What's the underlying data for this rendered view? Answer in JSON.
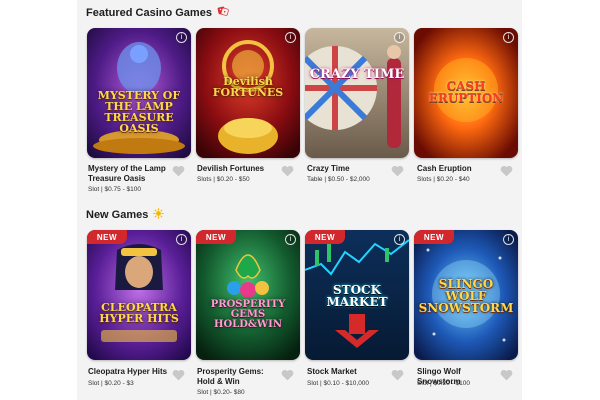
{
  "sections": {
    "featured": {
      "title": "Featured Casino Games",
      "icon": "dice-icon"
    },
    "new": {
      "title": "New Games",
      "icon": "sparkle-icon"
    }
  },
  "badges": {
    "new_label": "NEW"
  },
  "featured_games": [
    {
      "name": "Mystery of the Lamp Treasure Oasis",
      "meta": "Slot | $0.75 - $100",
      "logo": "MYSTERY OF THE LAMP TREASURE OASIS"
    },
    {
      "name": "Devilish Fortunes",
      "meta": "Slots | $0.20 - $50",
      "logo": "Devilish FORTUNES"
    },
    {
      "name": "Crazy Time",
      "meta": "Table | $0.50 - $2,000",
      "logo": "CRAZY TIME"
    },
    {
      "name": "Cash Eruption",
      "meta": "Slots | $0.20 - $40",
      "logo": "CASH ERUPTION"
    }
  ],
  "new_games": [
    {
      "name": "Cleopatra Hyper Hits",
      "meta": "Slot | $0.20 - $3",
      "logo": "CLEOPATRA HYPER HITS"
    },
    {
      "name": "Prosperity Gems: Hold & Win",
      "meta": "Slot | $0.20- $80",
      "logo": "PROSPERITY GEMS HOLD&WIN"
    },
    {
      "name": "Stock Market",
      "meta": "Slot | $0.10 - $10,000",
      "logo": "STOCK MARKET"
    },
    {
      "name": "Slingo Wolf Snowstorm",
      "meta": "Slot | $0.20 - $100",
      "logo": "SLINGO WOLF SNOWSTORM"
    }
  ],
  "colors": {
    "badge": "#d1282e",
    "heart": "#c8c8c8",
    "panel": "#f3f3f4"
  }
}
